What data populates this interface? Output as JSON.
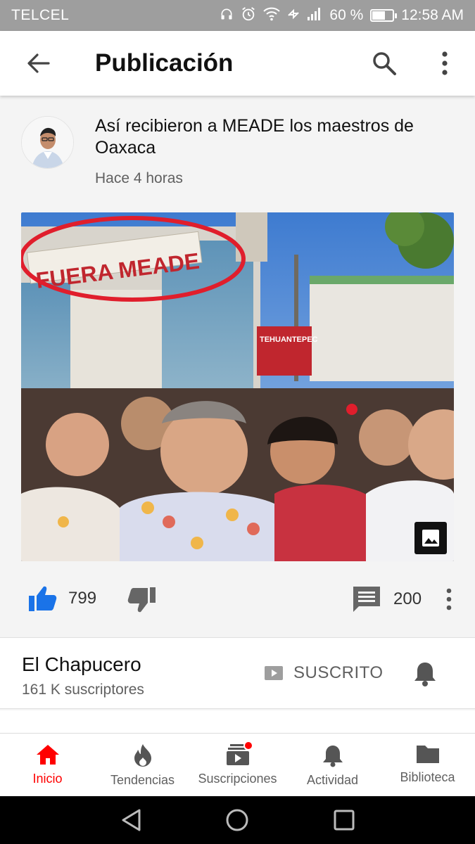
{
  "status_bar": {
    "carrier": "TELCEL",
    "battery_percent": "60 %",
    "battery_level": 0.6,
    "time": "12:58 AM",
    "icons": [
      "headphones-icon",
      "alarm-icon",
      "wifi-icon",
      "data-icon",
      "signal-icon",
      "battery-icon"
    ]
  },
  "app_bar": {
    "title": "Publicación",
    "icons": [
      "back-arrow-icon",
      "search-icon",
      "more-vert-icon"
    ]
  },
  "post": {
    "text": "Así recibieron a MEADE los maestros de Oaxaca",
    "time": "Hace 4 horas",
    "image_banner_text": "FUERA MEADE",
    "image_sign_text": "TEHUANTEPEC"
  },
  "actions": {
    "likes": "799",
    "comments": "200"
  },
  "channel": {
    "name": "El Chapucero",
    "subscribers": "161 K suscriptores",
    "subscribe_label": "SUSCRITO"
  },
  "bottom_nav": {
    "items": [
      {
        "label": "Inicio",
        "icon": "home-icon",
        "active": true
      },
      {
        "label": "Tendencias",
        "icon": "fire-icon"
      },
      {
        "label": "Suscripciones",
        "icon": "subscriptions-icon"
      },
      {
        "label": "Actividad",
        "icon": "bell-icon"
      },
      {
        "label": "Biblioteca",
        "icon": "folder-icon"
      }
    ]
  },
  "colors": {
    "accent": "#ff0000",
    "like": "#1a73e8",
    "status_bar": "#9e9e9e"
  }
}
